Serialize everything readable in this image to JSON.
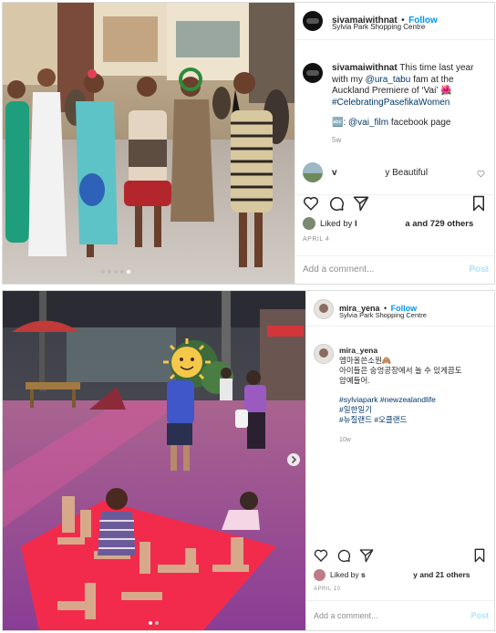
{
  "post1": {
    "username": "sivamaiwithnat",
    "follow_dot": "•",
    "follow_label": "Follow",
    "location": "Sylvia Park Shopping Centre",
    "caption_user": "sivamaiwithnat",
    "caption_text_1": " This time last year with my ",
    "caption_mention": "@ura_tabu",
    "caption_text_2": " fam at the Auckland Premiere of ‘Vai’ 🌺",
    "caption_hashtag": "#CelebratingPasefikaWomen",
    "caption_line_emoji": "🔤:",
    "caption_mention_2": "@vai_film",
    "caption_text_3": " facebook page",
    "caption_time": "5w",
    "comment_user": "v",
    "comment_text": "y Beautiful",
    "liked_prefix": "Liked by ",
    "liked_user": "l",
    "liked_suffix_bold": "a and 729 others",
    "date": "APRIL 4",
    "add_comment_placeholder": "Add a comment...",
    "post_button": "Post"
  },
  "post2": {
    "username": "mira_yena",
    "follow_dot": "•",
    "follow_label": "Follow",
    "location": "Sylvia Park Shopping Centre",
    "caption_user": "mira_yena",
    "caption_line_1": "엠마올쓴소원🙈",
    "caption_line_2": "아이들은 숭엉공장에서 놀 수 있게끔도",
    "caption_line_3": "암예들어.",
    "hashtags_line_1": "#sylviapark #newzealandlife",
    "hashtags_line_2": "#일한일기",
    "hashtags_line_3": "#뉴질랜드 #오클랜드",
    "caption_time": "10w",
    "liked_prefix": "Liked by ",
    "liked_user": "s",
    "liked_suffix_bold": "y and 21 others",
    "date": "APRIL 10",
    "add_comment_placeholder": "Add a comment...",
    "post_button": "Post"
  }
}
